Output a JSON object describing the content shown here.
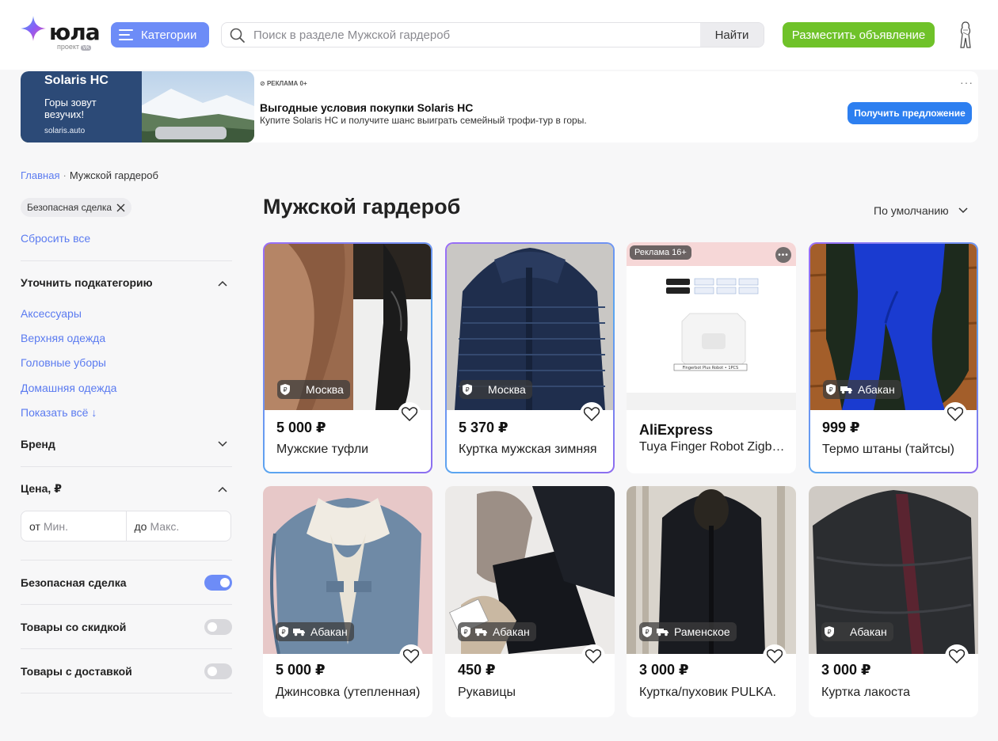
{
  "header": {
    "logo_text": "юла",
    "logo_sub": "проект",
    "logo_vk": "VK",
    "categories_label": "Категории",
    "search_placeholder": "Поиск в разделе Мужской гардероб",
    "search_button": "Найти",
    "post_button": "Разместить объявление",
    "colors": {
      "accent": "#6d8cf7",
      "post": "#6fc229"
    }
  },
  "ad": {
    "image_brand": "Solaris HC",
    "image_slogan": "Горы зовут везучих!",
    "image_site": "solaris.auto",
    "meta": "РЕКЛАМА 0+",
    "title": "Выгодные условия покупки Solaris HC",
    "description": "Купите Solaris HC и получите шанс выиграть семейный трофи-тур в горы.",
    "cta": "Получить предложение",
    "more": "···"
  },
  "breadcrumb": {
    "home": "Главная",
    "sep": "·",
    "current": "Мужской гардероб"
  },
  "filters": {
    "active_chip": "Безопасная сделка",
    "reset": "Сбросить все",
    "subcategory_title": "Уточнить подкатегорию",
    "subcategories": [
      "Аксессуары",
      "Верхняя одежда",
      "Головные уборы",
      "Домашняя одежда"
    ],
    "show_all": "Показать всё ↓",
    "brand_title": "Бренд",
    "price_title": "Цена, ₽",
    "price_from_label": "от",
    "price_from_placeholder": "Мин.",
    "price_to_label": "до",
    "price_to_placeholder": "Макс.",
    "toggles": [
      {
        "label": "Безопасная сделка",
        "on": true
      },
      {
        "label": "Товары со скидкой",
        "on": false
      },
      {
        "label": "Товары с доставкой",
        "on": false
      }
    ]
  },
  "main": {
    "title": "Мужской гардероб",
    "sort": "По умолчанию",
    "cards": [
      {
        "price": "5 000 ₽",
        "title": "Мужские туфли",
        "location": "Москва",
        "delivery": false,
        "promo": true
      },
      {
        "price": "5 370 ₽",
        "title": "Куртка мужская зимняя",
        "location": "Москва",
        "delivery": false,
        "promo": true
      },
      {
        "ad": true,
        "ad_label": "Реклама 16+",
        "brand": "AliExpress",
        "product": "Tuya Finger Robot Zigbee"
      },
      {
        "price": "999 ₽",
        "title": "Термо штаны (тайтсы)",
        "location": "Абакан",
        "delivery": true,
        "promo": true
      },
      {
        "price": "5 000 ₽",
        "title": "Джинсовка (утепленная)",
        "location": "Абакан",
        "delivery": true,
        "promo": false
      },
      {
        "price": "450 ₽",
        "title": "Рукавицы",
        "location": "Абакан",
        "delivery": true,
        "promo": false
      },
      {
        "price": "3 000 ₽",
        "title": "Куртка/пуховик PULKA.",
        "location": "Раменское",
        "delivery": true,
        "promo": false
      },
      {
        "price": "3 000 ₽",
        "title": "Куртка лакоста",
        "location": "Абакан",
        "delivery": false,
        "promo": false
      }
    ]
  }
}
